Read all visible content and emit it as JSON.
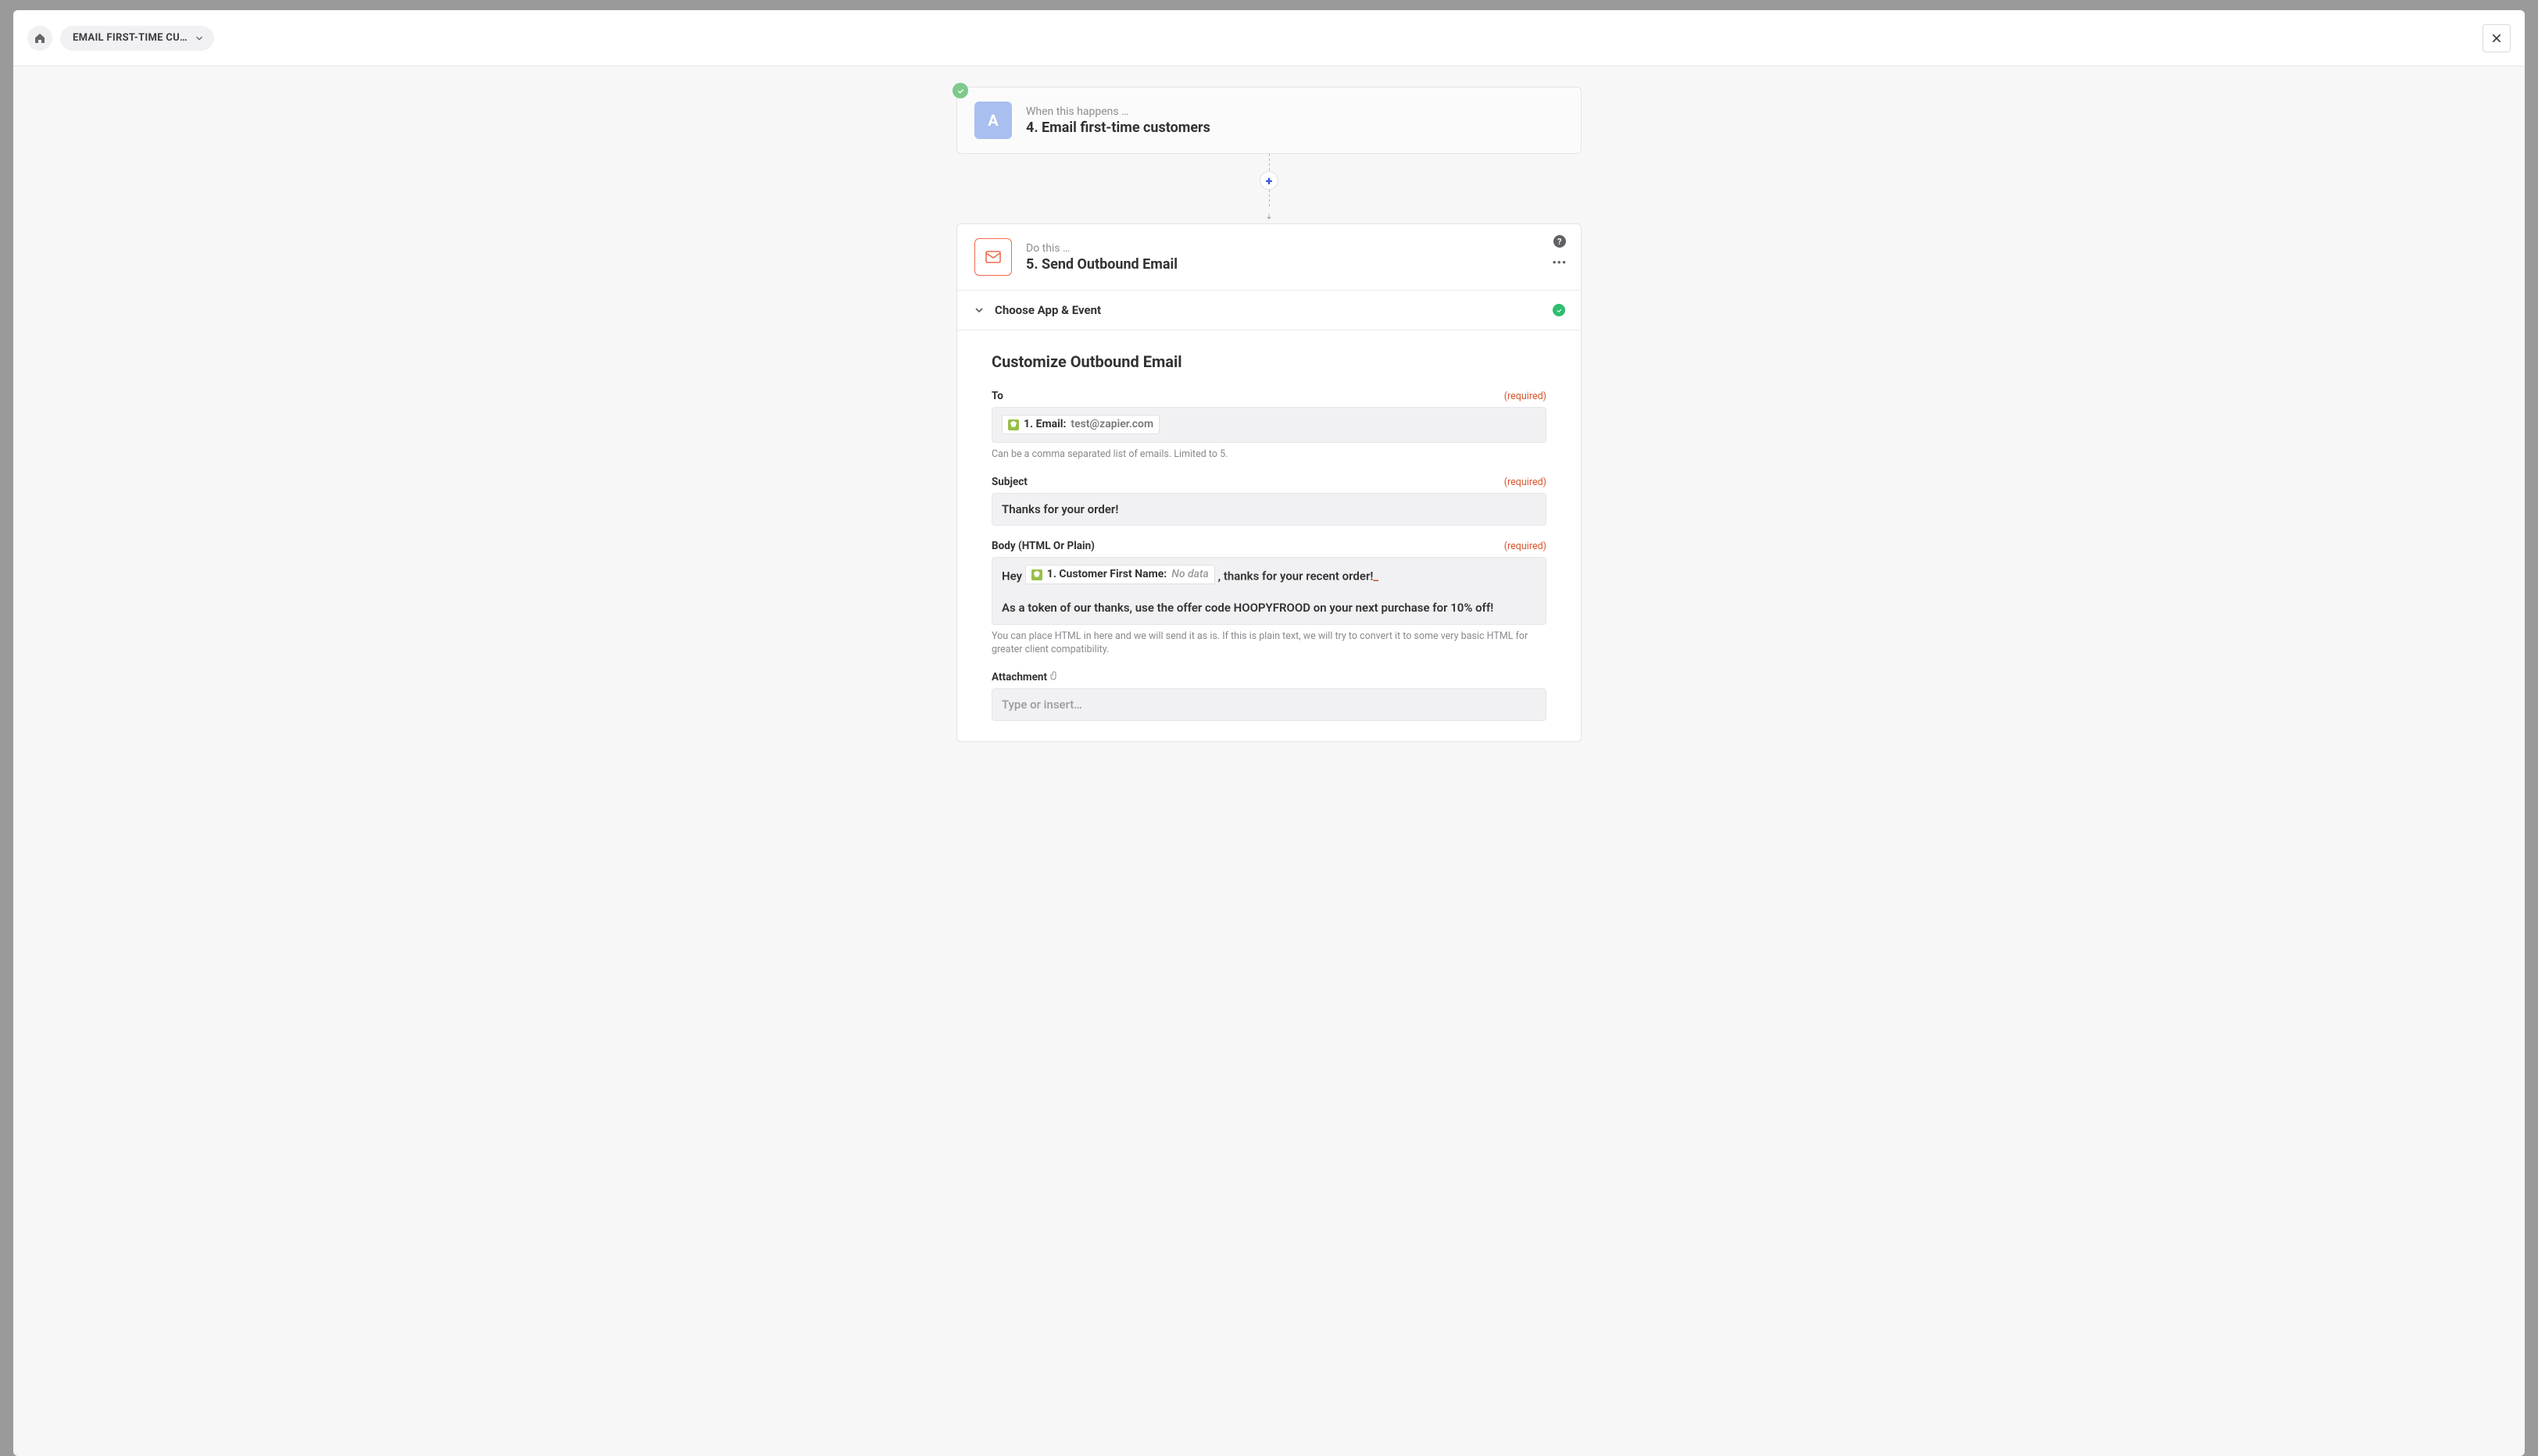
{
  "header": {
    "breadcrumb": "EMAIL FIRST-TIME CU…"
  },
  "trigger": {
    "badge": "A",
    "hint": "When this happens …",
    "title": "4. Email first-time customers"
  },
  "action": {
    "hint": "Do this …",
    "title": "5. Send Outbound Email",
    "help_sym": "?",
    "more_sym": "•••"
  },
  "section": {
    "choose_label": "Choose App & Event"
  },
  "form": {
    "title": "Customize Outbound Email",
    "required_label": "(required)",
    "to": {
      "label": "To",
      "pill_label": "1. Email:",
      "pill_value": "test@zapier.com",
      "help": "Can be a comma separated list of emails. Limited to 5."
    },
    "subject": {
      "label": "Subject",
      "value": "Thanks for your order!"
    },
    "body": {
      "label": "Body (HTML Or Plain)",
      "line1_pre": "Hey",
      "line1_pill_label": "1. Customer First Name:",
      "line1_pill_value": "No data",
      "line1_post": ", thanks for your recent order!",
      "line2": "As a token of our thanks, use the offer code HOOPYFROOD on your next purchase for 10% off!",
      "help": "You can place HTML in here and we will send it as is. If this is plain text, we will try to convert it to some very basic HTML for greater client compatibility."
    },
    "attachment": {
      "label": "Attachment",
      "placeholder": "Type or insert…"
    }
  }
}
